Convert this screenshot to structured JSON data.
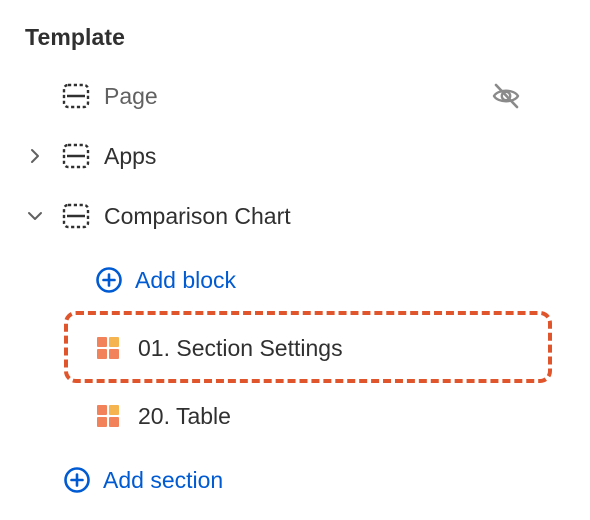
{
  "sidebar": {
    "heading": "Template",
    "items": [
      {
        "label": "Page",
        "hidden": true
      },
      {
        "label": "Apps",
        "expanded": false
      },
      {
        "label": "Comparison Chart",
        "expanded": true
      }
    ],
    "comparison_chart": {
      "add_block_label": "Add block",
      "blocks": [
        {
          "label": "01. Section Settings",
          "highlighted": true
        },
        {
          "label": "20. Table",
          "highlighted": false
        }
      ]
    },
    "add_section_label": "Add section"
  },
  "colors": {
    "link": "#005bd3",
    "text": "#303030",
    "muted_text": "#616161",
    "highlight_border": "#e0552b",
    "block_icon_primary": "#f2825a",
    "block_icon_secondary": "#f6b450"
  },
  "icons": {
    "section": "section-icon",
    "hidden": "eye-slash-icon",
    "collapsed": "chevron-right-icon",
    "expanded": "chevron-down-icon",
    "add": "circle-plus-icon",
    "block": "block-grid-icon"
  }
}
